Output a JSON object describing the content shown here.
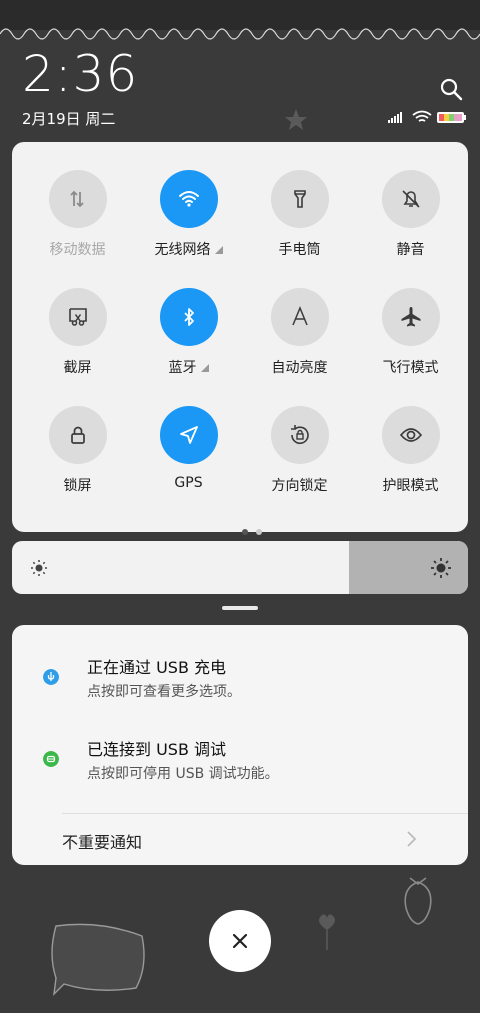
{
  "status": {
    "time": "2:36",
    "date": "2月19日 周二"
  },
  "quick_settings": {
    "tiles": [
      {
        "label": "移动数据",
        "state": "off",
        "dim": true,
        "icon": "mobile-data-icon"
      },
      {
        "label": "无线网络",
        "state": "on",
        "dim": false,
        "icon": "wifi-icon",
        "expand": true
      },
      {
        "label": "手电筒",
        "state": "off",
        "dim": false,
        "icon": "flashlight-icon"
      },
      {
        "label": "静音",
        "state": "off",
        "dim": false,
        "icon": "mute-bell-icon"
      },
      {
        "label": "截屏",
        "state": "off",
        "dim": false,
        "icon": "screenshot-icon"
      },
      {
        "label": "蓝牙",
        "state": "on",
        "dim": false,
        "icon": "bluetooth-icon",
        "expand": true
      },
      {
        "label": "自动亮度",
        "state": "off",
        "dim": false,
        "icon": "auto-brightness-icon"
      },
      {
        "label": "飞行模式",
        "state": "off",
        "dim": false,
        "icon": "airplane-icon"
      },
      {
        "label": "锁屏",
        "state": "off",
        "dim": false,
        "icon": "lock-icon"
      },
      {
        "label": "GPS",
        "state": "on",
        "dim": false,
        "icon": "location-icon"
      },
      {
        "label": "方向锁定",
        "state": "off",
        "dim": false,
        "icon": "rotation-lock-icon"
      },
      {
        "label": "护眼模式",
        "state": "off",
        "dim": false,
        "icon": "eye-icon"
      }
    ],
    "page_count": 2,
    "current_page": 1
  },
  "brightness": {
    "level": 0.74
  },
  "notifications": [
    {
      "title": "正在通过 USB 充电",
      "subtitle": "点按即可查看更多选项。",
      "icon": "usb-charging-icon",
      "color": "#2e9ee8"
    },
    {
      "title": "已连接到 USB 调试",
      "subtitle": "点按即可停用 USB 调试功能。",
      "icon": "android-debug-icon",
      "color": "#3cb84a"
    }
  ],
  "unimportant_label": "不重要通知",
  "colors": {
    "accent": "#1b98f5",
    "panel": "#f2f2f2",
    "background": "#3a3a3a"
  }
}
